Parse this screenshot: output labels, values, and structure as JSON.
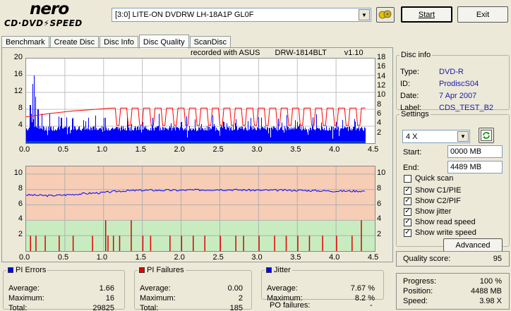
{
  "header": {
    "logo_top": "nero",
    "logo_bottom": "CD·DVD⚡SPEED",
    "drive": "[3:0]  LITE-ON DVDRW LH-18A1P GL0F",
    "start_label": "Start",
    "exit_label": "Exit",
    "dvd_icon": "disc-eject-icon"
  },
  "tabs": [
    {
      "label": "Benchmark",
      "active": false
    },
    {
      "label": "Create Disc",
      "active": false
    },
    {
      "label": "Disc Info",
      "active": false
    },
    {
      "label": "Disc Quality",
      "active": true
    },
    {
      "label": "ScanDisc",
      "active": false
    }
  ],
  "recorded": {
    "text": "recorded with ASUS",
    "drive": "DRW-1814BLT",
    "version": "v1.10"
  },
  "disc_info": {
    "title": "Disc info",
    "rows": [
      {
        "label": "Type:",
        "value": "DVD-R"
      },
      {
        "label": "ID:",
        "value": "ProdiscS04"
      },
      {
        "label": "Date:",
        "value": "7 Apr 2007"
      },
      {
        "label": "Label:",
        "value": "CDS_TEST_B2"
      }
    ]
  },
  "settings": {
    "title": "Settings",
    "speed": "4 X",
    "start_label": "Start:",
    "start_value": "0000 MB",
    "end_label": "End:",
    "end_value": "4489 MB",
    "checkboxes": [
      {
        "label": "Quick scan",
        "checked": false
      },
      {
        "label": "Show C1/PIE",
        "checked": true
      },
      {
        "label": "Show C2/PIF",
        "checked": true
      },
      {
        "label": "Show jitter",
        "checked": true
      },
      {
        "label": "Show read speed",
        "checked": true
      },
      {
        "label": "Show write speed",
        "checked": true
      }
    ],
    "advanced_label": "Advanced"
  },
  "quality": {
    "label": "Quality score:",
    "value": "95"
  },
  "progress": {
    "rows": [
      {
        "label": "Progress:",
        "value": "100 %"
      },
      {
        "label": "Position:",
        "value": "4488 MB"
      },
      {
        "label": "Speed:",
        "value": "3.98 X"
      }
    ]
  },
  "pi_errors": {
    "title": "PI Errors",
    "color": "#0000ff",
    "rows": [
      {
        "label": "Average:",
        "value": "1.66"
      },
      {
        "label": "Maximum:",
        "value": "16"
      },
      {
        "label": "Total:",
        "value": "29825"
      }
    ]
  },
  "pi_failures": {
    "title": "PI Failures",
    "color": "#e00000",
    "rows": [
      {
        "label": "Average:",
        "value": "0.00"
      },
      {
        "label": "Maximum:",
        "value": "2"
      },
      {
        "label": "Total:",
        "value": "185"
      }
    ]
  },
  "jitter": {
    "title": "Jitter",
    "color": "#0000ff",
    "rows": [
      {
        "label": "Average:",
        "value": "7.67 %"
      },
      {
        "label": "Maximum:",
        "value": "8.2 %"
      }
    ],
    "po_label": "PO failures:",
    "po_value": "-"
  },
  "chart_data": [
    {
      "type": "bar",
      "name": "pi-errors-chart",
      "x_ticks": [
        "0.0",
        "0.5",
        "1.0",
        "1.5",
        "2.0",
        "2.5",
        "3.0",
        "3.5",
        "4.0",
        "4.5"
      ],
      "y_left_ticks": [
        "20",
        "16",
        "12",
        "8",
        "4"
      ],
      "y_right_ticks": [
        "18",
        "16",
        "14",
        "12",
        "10",
        "8",
        "6",
        "4",
        "2"
      ],
      "xlim": [
        0,
        4.5
      ],
      "ylim_left": [
        0,
        20
      ],
      "ylim_right": [
        0,
        18
      ],
      "x_end": 4.38,
      "pie_base": 3.5,
      "pie_spikes": [
        [
          0.05,
          9
        ],
        [
          0.08,
          14
        ],
        [
          0.1,
          16
        ],
        [
          0.12,
          11
        ],
        [
          0.15,
          8
        ],
        [
          0.2,
          7
        ],
        [
          0.3,
          7
        ],
        [
          0.45,
          6
        ],
        [
          0.6,
          6
        ],
        [
          0.8,
          6
        ],
        [
          1.0,
          6
        ],
        [
          1.5,
          5
        ],
        [
          1.63,
          6
        ],
        [
          2.0,
          5
        ],
        [
          2.55,
          5
        ],
        [
          3.0,
          5
        ],
        [
          3.5,
          5
        ],
        [
          4.0,
          5
        ]
      ],
      "read_speed_level": 8.3,
      "read_speed_start": 6.2,
      "series": [
        {
          "name": "PI Errors",
          "color": "#0000ff"
        },
        {
          "name": "read speed",
          "color": "#ff0000"
        },
        {
          "name": "write speed",
          "color": "#00bb00"
        }
      ]
    },
    {
      "type": "line",
      "name": "jitter-pif-chart",
      "x_ticks": [
        "0.0",
        "0.5",
        "1.0",
        "1.5",
        "2.0",
        "2.5",
        "3.0",
        "3.5",
        "4.0",
        "4.5"
      ],
      "y_left_ticks": [
        "10",
        "8",
        "6",
        "4",
        "2"
      ],
      "y_right_ticks": [
        "10",
        "8",
        "6",
        "4",
        "2"
      ],
      "xlim": [
        0,
        4.5
      ],
      "ylim": [
        0,
        11
      ],
      "x_end": 4.38,
      "jitter": [
        [
          0.0,
          7.3
        ],
        [
          0.3,
          7.2
        ],
        [
          0.5,
          7.3
        ],
        [
          0.8,
          7.5
        ],
        [
          1.0,
          7.6
        ],
        [
          1.2,
          7.8
        ],
        [
          1.5,
          7.9
        ],
        [
          1.8,
          7.9
        ],
        [
          2.0,
          7.9
        ],
        [
          2.5,
          8.0
        ],
        [
          3.0,
          7.9
        ],
        [
          3.5,
          7.9
        ],
        [
          4.0,
          7.8
        ],
        [
          4.38,
          7.8
        ]
      ],
      "pif": [
        [
          0.05,
          1
        ],
        [
          0.12,
          1
        ],
        [
          0.24,
          1
        ],
        [
          0.42,
          1
        ],
        [
          0.6,
          1
        ],
        [
          0.85,
          1
        ],
        [
          1.02,
          2
        ],
        [
          1.05,
          1
        ],
        [
          1.12,
          1
        ],
        [
          1.2,
          1
        ],
        [
          1.35,
          2
        ],
        [
          1.5,
          1
        ],
        [
          1.6,
          1
        ],
        [
          1.85,
          1
        ],
        [
          2.0,
          1
        ],
        [
          2.15,
          1
        ],
        [
          2.3,
          1
        ],
        [
          2.5,
          1
        ],
        [
          2.7,
          1
        ],
        [
          2.8,
          1
        ],
        [
          3.0,
          1
        ],
        [
          3.2,
          1
        ],
        [
          3.35,
          1
        ],
        [
          3.5,
          1
        ],
        [
          3.65,
          1
        ],
        [
          3.82,
          1
        ],
        [
          4.0,
          1
        ],
        [
          4.2,
          1
        ],
        [
          4.32,
          2
        ]
      ],
      "bands": [
        {
          "from": 0,
          "to": 4,
          "color": "#c8ecc0"
        },
        {
          "from": 4,
          "to": 11,
          "color": "#f7cdb6"
        }
      ],
      "series": [
        {
          "name": "Jitter",
          "color": "#0000ff"
        },
        {
          "name": "PI Failures",
          "color": "#e00000"
        }
      ]
    }
  ]
}
